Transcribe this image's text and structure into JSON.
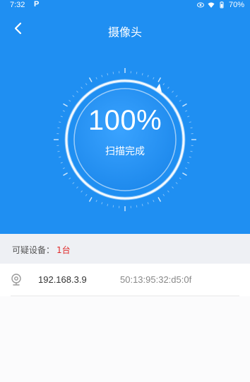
{
  "status_bar": {
    "time": "7:32",
    "notification_letter": "P",
    "battery": "70%"
  },
  "header": {
    "title": "摄像头"
  },
  "scan": {
    "percent": "100%",
    "status_text": "扫描完成",
    "progress": 1.0
  },
  "summary": {
    "label": "可疑设备：",
    "count": "1台",
    "count_color": "#e02b2b"
  },
  "devices": [
    {
      "ip": "192.168.3.9",
      "mac": "50:13:95:32:d5:0f",
      "icon": "camera-icon"
    }
  ],
  "colors": {
    "header_blue": "#1f8ff2"
  }
}
